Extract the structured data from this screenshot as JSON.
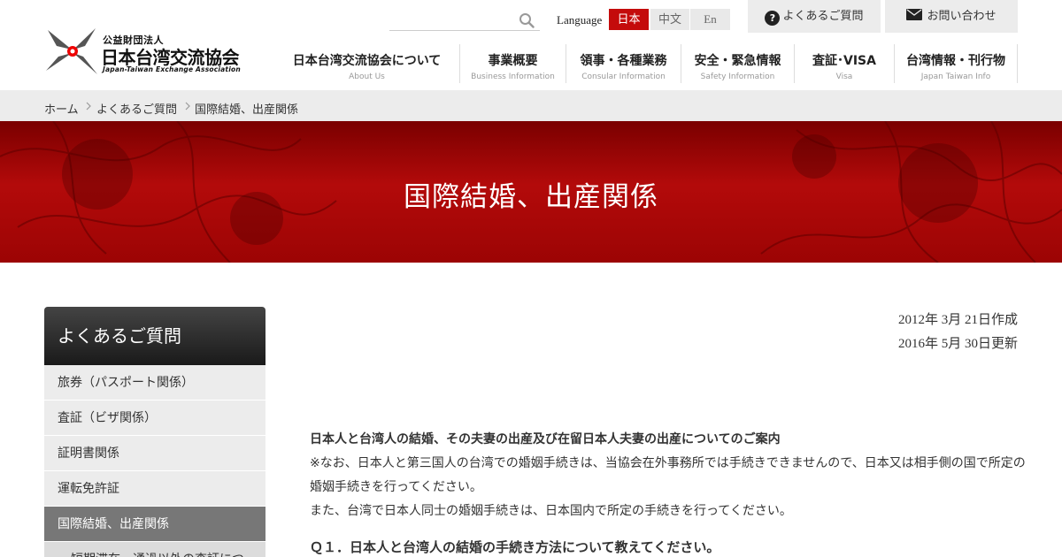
{
  "header": {
    "logo": {
      "small": "公益財団法人",
      "name": "日本台湾交流協会",
      "en": "Japan-Taiwan Exchange Association"
    },
    "search": {
      "placeholder": "",
      "icon": "search-icon"
    },
    "language": {
      "label": "Language",
      "options": [
        "日本",
        "中文",
        "En"
      ],
      "active": "日本",
      "active_color": "#c40b0b"
    },
    "faq_link": "よくあるご質問",
    "contact_link": "お問い合わせ",
    "nav": [
      {
        "jp": "日本台湾交流協会について",
        "en": "About Us"
      },
      {
        "jp": "事業概要",
        "en": "Business Information"
      },
      {
        "jp": "領事・各種業務",
        "en": "Consular Information"
      },
      {
        "jp": "安全・緊急情報",
        "en": "Safety Information"
      },
      {
        "jp": "査証･VISA",
        "en": "Visa"
      },
      {
        "jp": "台湾情報・刊行物",
        "en": "Japan Taiwan Info"
      }
    ]
  },
  "breadcrumb": [
    "ホーム",
    "よくあるご質問",
    "国際結婚、出産関係"
  ],
  "hero": {
    "title": "国際結婚、出産関係",
    "color": "#a80808"
  },
  "sidebar": {
    "title": "よくあるご質問",
    "items": [
      "旅券（パスポート関係）",
      "査証（ビザ関係）",
      "証明書関係",
      "運転免許証",
      "国際結婚、出産関係"
    ],
    "active": "国際結婚、出産関係",
    "sub_item": "短期滞在、通過以外の査証につ"
  },
  "content": {
    "created": "2012年 3月 21日作成",
    "updated": "2016年 5月 30日更新",
    "lead": "日本人と台湾人の結婚、その夫妻の出産及び在留日本人夫妻の出産についてのご案内",
    "note1": "※なお、日本人と第三国人の台湾での婚姻手続きは、当協会在外事務所では手続きできませんので、日本又は相手側の国で所定の婚姻手続きを行ってください。",
    "note2": "また、台湾で日本人同士の婚姻手続きは、日本国内で所定の手続きを行ってください。",
    "q1": "Ｑ１．日本人と台湾人の結婚の手続き方法について教えてください。"
  }
}
